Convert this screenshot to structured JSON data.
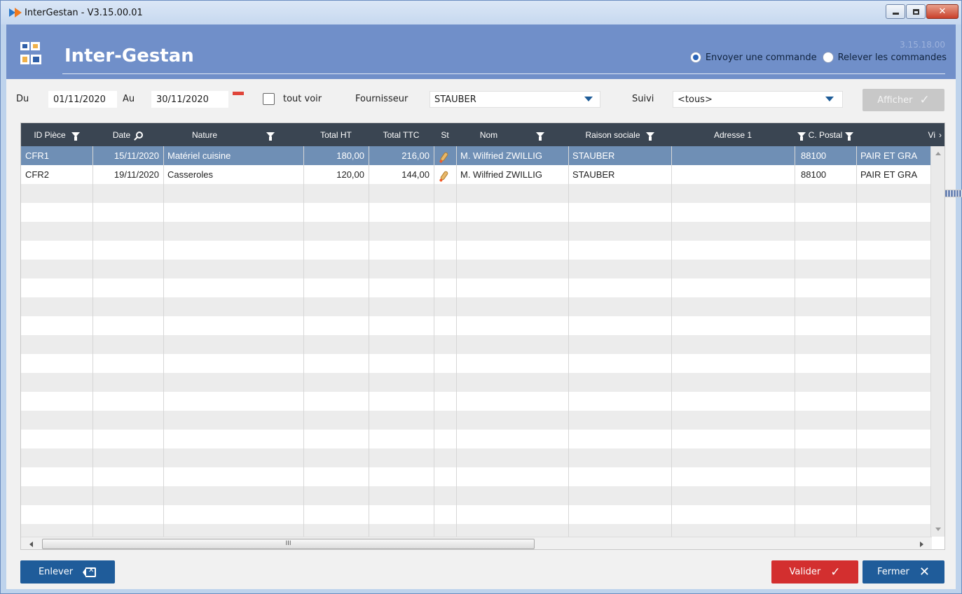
{
  "window": {
    "title": "InterGestan - V3.15.00.01",
    "colors": {
      "titlebar": "#c6d8ef",
      "header": "#708fc9",
      "grid_header": "#3a4552",
      "selected_row": "#6f8fb5",
      "primary_button": "#1f5c9a",
      "validate_button": "#d32f2f"
    }
  },
  "header": {
    "title": "Inter-Gestan",
    "version": "3.15.18.00",
    "radio_send": "Envoyer une commande",
    "radio_fetch": "Relever les commandes",
    "selected_radio": "send"
  },
  "filters": {
    "du_label": "Du",
    "du_value": "01/11/2020",
    "au_label": "Au",
    "au_value": "30/11/2020",
    "tout_voir_label": "tout voir",
    "fournisseur_label": "Fournisseur",
    "fournisseur_value": "STAUBER",
    "suivi_label": "Suivi",
    "suivi_value": "<tous>",
    "afficher_label": "Afficher"
  },
  "grid": {
    "columns": [
      {
        "key": "id",
        "label": "ID Pièce",
        "icon": "filter-icon"
      },
      {
        "key": "date",
        "label": "Date",
        "icon": "search-icon"
      },
      {
        "key": "nature",
        "label": "Nature",
        "icon": "filter-icon"
      },
      {
        "key": "total_ht",
        "label": "Total HT",
        "icon": ""
      },
      {
        "key": "total_ttc",
        "label": "Total TTC",
        "icon": ""
      },
      {
        "key": "st",
        "label": "St",
        "icon": ""
      },
      {
        "key": "nom",
        "label": "Nom",
        "icon": "filter-icon"
      },
      {
        "key": "raison",
        "label": "Raison sociale",
        "icon": "filter-icon"
      },
      {
        "key": "adresse1",
        "label": "Adresse 1",
        "icon": ""
      },
      {
        "key": "cp",
        "label": "C. Postal",
        "icon": "filter-icon"
      },
      {
        "key": "ville",
        "label": "Vi",
        "icon": "chevron-right-icon"
      }
    ],
    "rows": [
      {
        "id": "CFR1",
        "date": "15/11/2020",
        "nature": "Matériel cuisine",
        "total_ht": "180,00",
        "total_ttc": "216,00",
        "st": "rocket-icon",
        "nom": "M. Wilfried ZWILLIG",
        "raison": "STAUBER",
        "adresse1": "",
        "cp": "88100",
        "ville": "PAIR ET GRA",
        "selected": true
      },
      {
        "id": "CFR2",
        "date": "19/11/2020",
        "nature": "Casseroles",
        "total_ht": "120,00",
        "total_ttc": "144,00",
        "st": "rocket-icon",
        "nom": "M. Wilfried ZWILLIG",
        "raison": "STAUBER",
        "adresse1": "",
        "cp": "88100",
        "ville": "PAIR ET GRA",
        "selected": false
      }
    ],
    "hscroll_thumb_label": "III"
  },
  "footer": {
    "enlever_label": "Enlever",
    "valider_label": "Valider",
    "fermer_label": "Fermer"
  }
}
